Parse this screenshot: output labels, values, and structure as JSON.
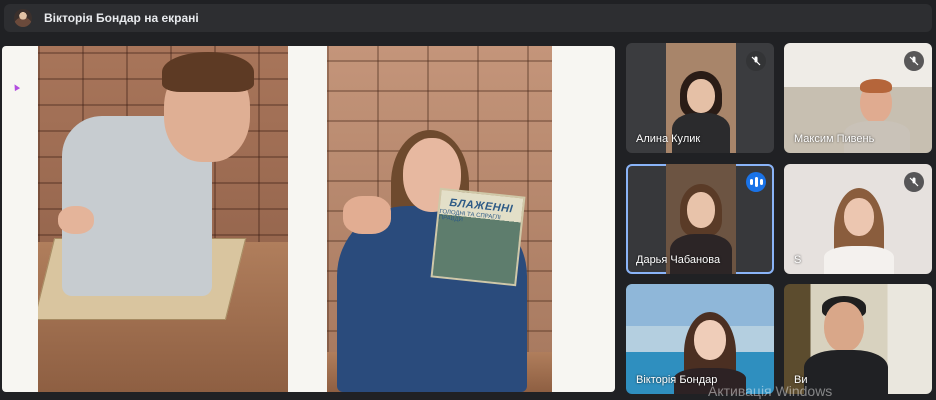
{
  "header": {
    "title": "Вікторія Бондар на екрані"
  },
  "shared_screen": {
    "book_title": "БЛАЖЕННІ",
    "book_subtitle": "ГОЛОДНІ ТА СПРАГЛІ ПРАВДИ"
  },
  "participants": [
    {
      "name": "Алина Кулик",
      "mic": "muted-mic-icon"
    },
    {
      "name": "Максим Пивень",
      "mic": "muted-mic-icon"
    },
    {
      "name": "Дарья Чабанова",
      "mic": "speaking-indicator-icon",
      "active": true
    },
    {
      "name": "S",
      "mic": "muted-mic-icon"
    },
    {
      "name": "Вікторія Бондар"
    },
    {
      "name": "Ви"
    }
  ],
  "watermark": "Активація Windows",
  "colors": {
    "accent": "#8ab4f8",
    "speaking": "#1a73e8",
    "background": "#202124"
  }
}
